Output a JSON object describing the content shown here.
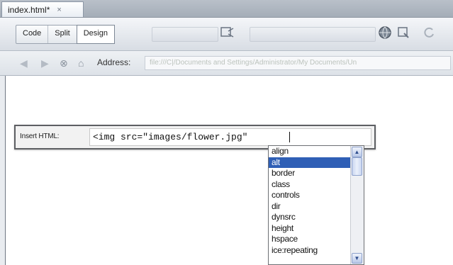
{
  "document_tab": {
    "title": "index.html*",
    "close_glyph": "×"
  },
  "view_buttons": {
    "code": "Code",
    "split": "Split",
    "design": "Design"
  },
  "address_bar": {
    "label": "Address:",
    "value": "file:///C|/Documents and Settings/Administrator/My Documents/Un"
  },
  "insert_html": {
    "label": "Insert HTML:",
    "value": "<img src=\"images/flower.jpg\" "
  },
  "code_hints": {
    "items": [
      "align",
      "alt",
      "border",
      "class",
      "controls",
      "dir",
      "dynsrc",
      "height",
      "hspace",
      "ice:repeating"
    ],
    "selected_index": 1
  },
  "colors": {
    "selection": "#2f5fb6",
    "panel_border": "#5d5f63"
  }
}
